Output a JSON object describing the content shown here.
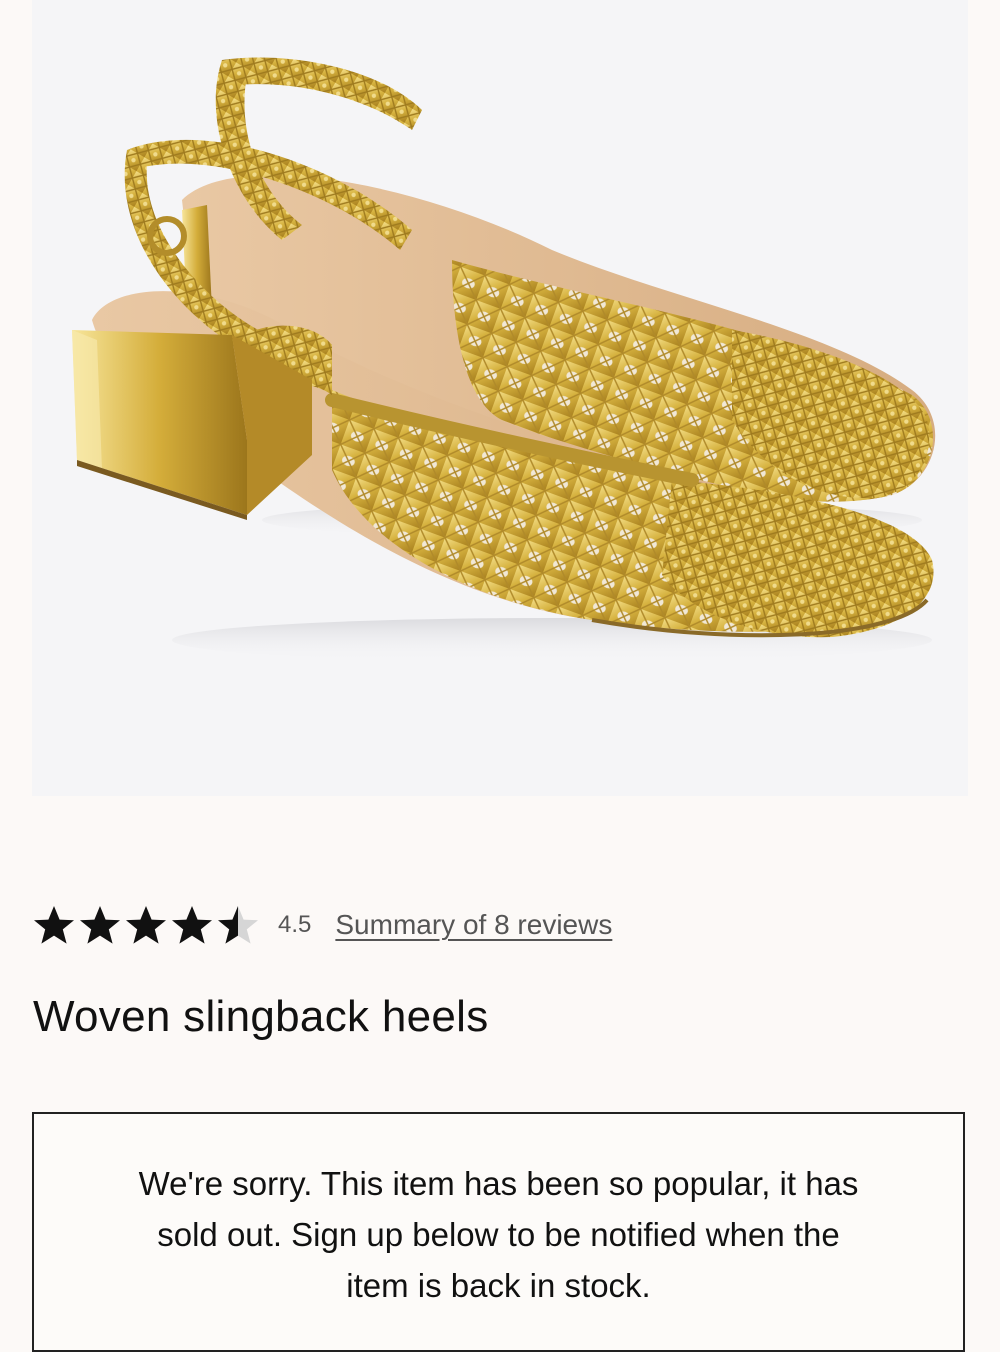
{
  "product": {
    "image_alt": "Gold woven slingback heels",
    "image_subject": "shoe-photo",
    "name": "Woven slingback heels"
  },
  "rating": {
    "stars_filled_fraction": 0.9,
    "value": "4.5",
    "reviews_link": "Summary of 8 reviews"
  },
  "availability": {
    "message": "We're sorry. This item has been so popular, it has sold out. Sign up below to be notified when the item is back in stock."
  },
  "colors": {
    "page_bg": "#fcf9f7",
    "image_bg": "#f5f5f7",
    "gold": "#d8b548",
    "text": "#111111",
    "muted": "#555555"
  }
}
